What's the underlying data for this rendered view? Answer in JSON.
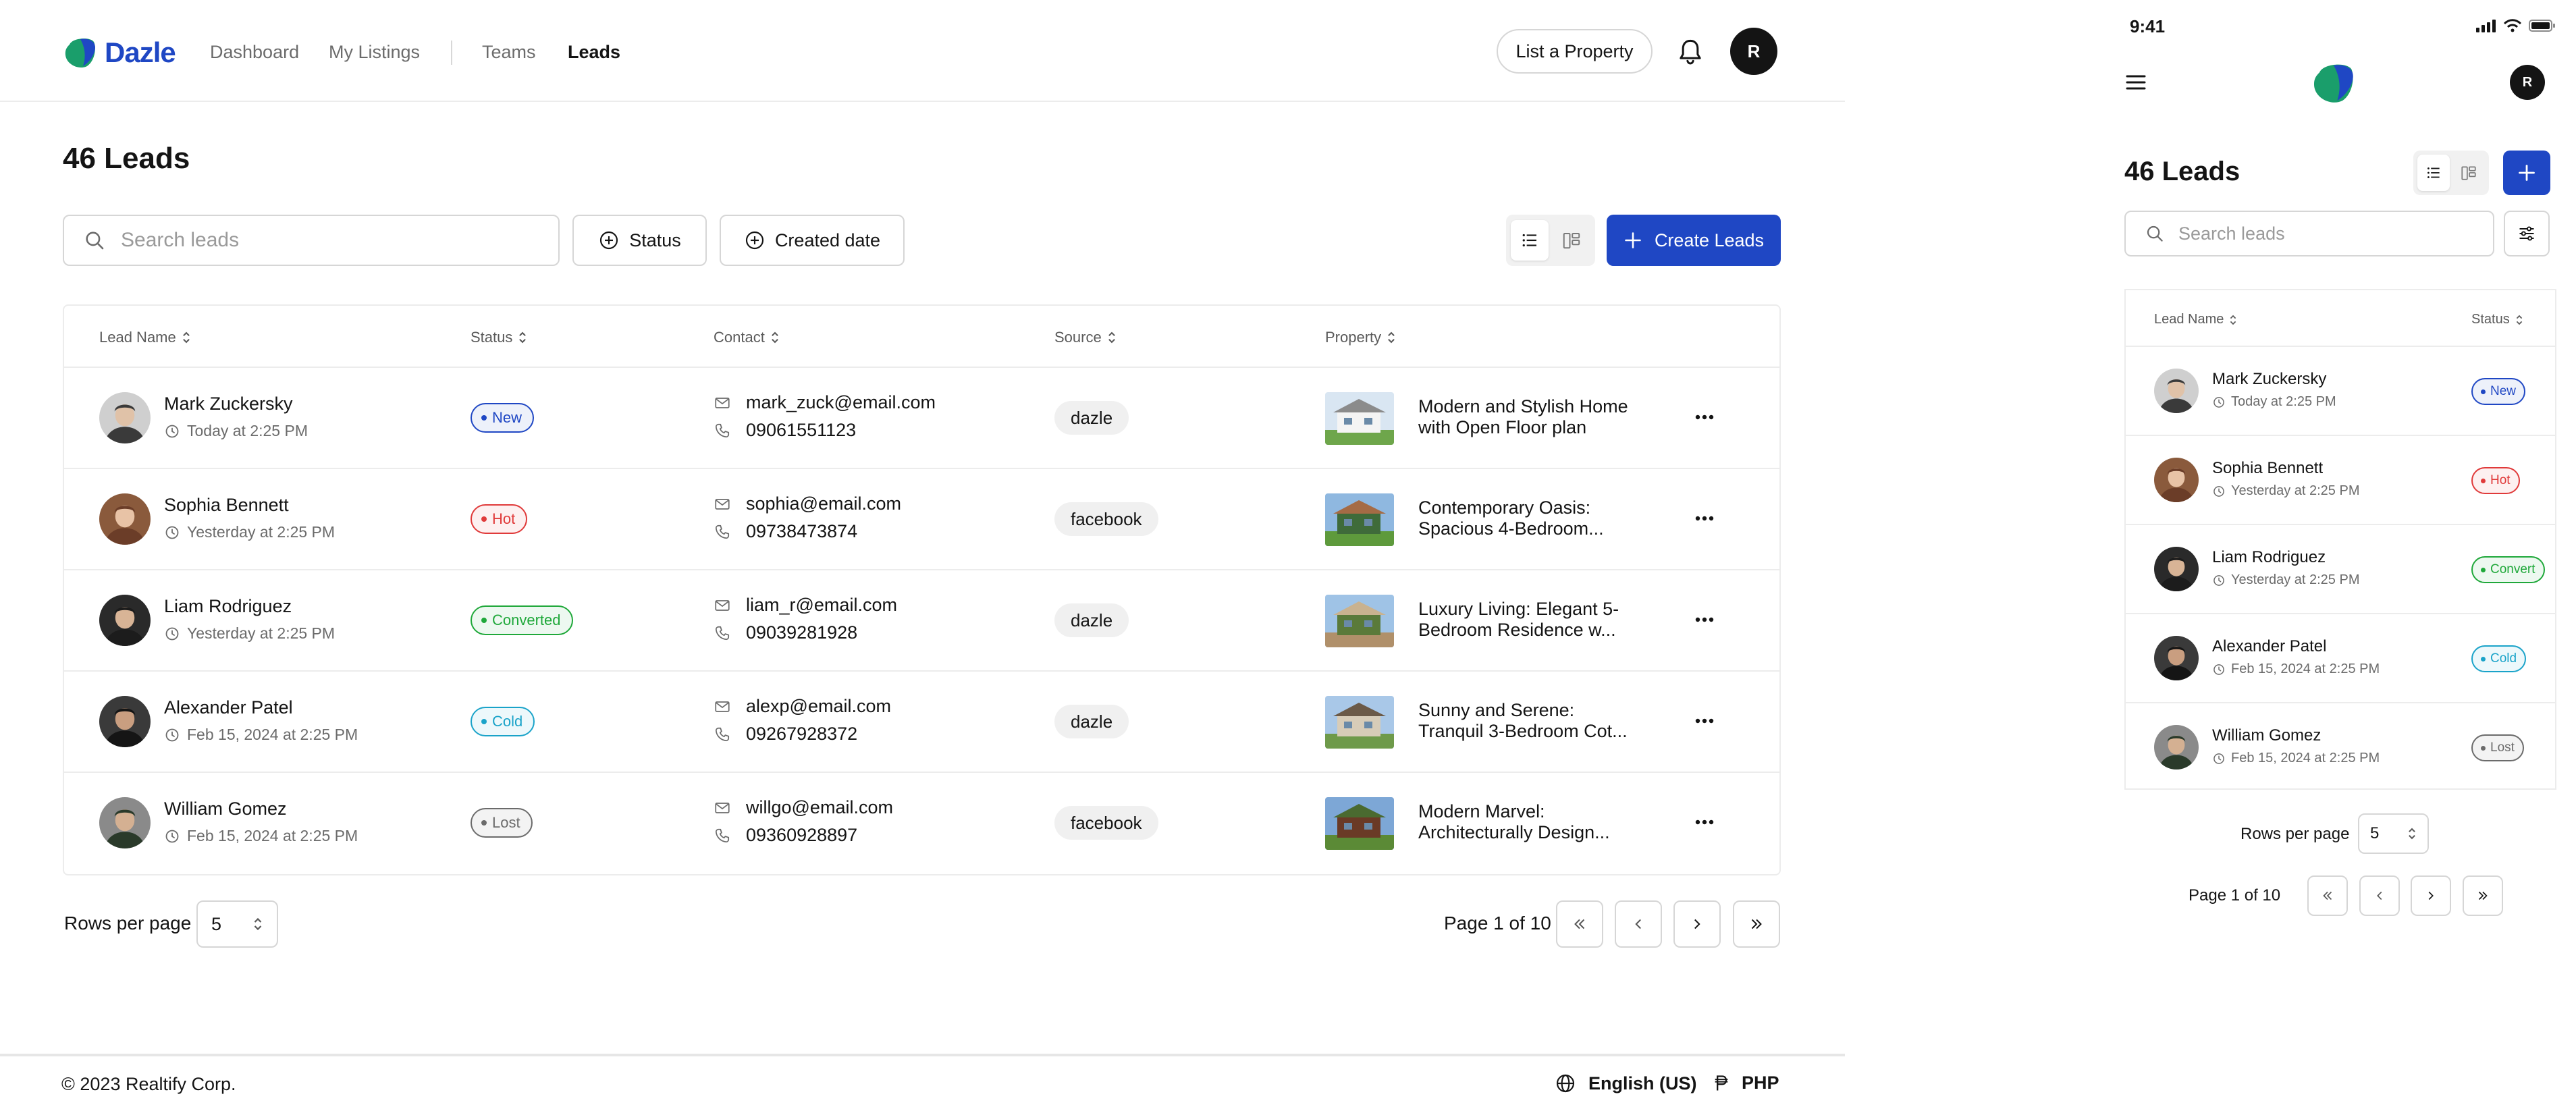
{
  "brand": {
    "name": "Dazle",
    "accent": "#1f47c4"
  },
  "nav": {
    "items": [
      {
        "label": "Dashboard",
        "active": false
      },
      {
        "label": "My Listings",
        "active": false
      },
      {
        "label": "Teams",
        "active": false
      },
      {
        "label": "Leads",
        "active": true
      }
    ],
    "list_property_label": "List a Property",
    "avatar_initial": "R"
  },
  "page": {
    "title": "46 Leads",
    "search_placeholder": "Search leads",
    "filters": [
      {
        "label": "Status",
        "icon": "plus-circle-icon"
      },
      {
        "label": "Created date",
        "icon": "plus-circle-icon"
      }
    ],
    "create_label": "Create Leads",
    "view_mode": "list"
  },
  "table": {
    "headers": [
      "Lead Name",
      "Status",
      "Contact",
      "Source",
      "Property"
    ],
    "rows": [
      {
        "name": "Mark Zuckersky",
        "time": "Today at 2:25 PM",
        "status": "New",
        "status_color": "#1f47c4",
        "email": "mark_zuck@email.com",
        "phone": "09061551123",
        "source": "dazle",
        "property": "Modern and Stylish Home with Open Floor plan"
      },
      {
        "name": "Sophia Bennett",
        "time": "Yesterday at 2:25 PM",
        "status": "Hot",
        "status_color": "#e03a3a",
        "email": "sophia@email.com",
        "phone": "09738473874",
        "source": "facebook",
        "property": "Contemporary Oasis: Spacious 4-Bedroom..."
      },
      {
        "name": "Liam Rodriguez",
        "time": "Yesterday at 2:25 PM",
        "status": "Converted",
        "status_color": "#1fa83a",
        "email": "liam_r@email.com",
        "phone": "09039281928",
        "source": "dazle",
        "property": "Luxury Living: Elegant 5-Bedroom Residence w..."
      },
      {
        "name": "Alexander Patel",
        "time": "Feb 15, 2024 at 2:25 PM",
        "status": "Cold",
        "status_color": "#1aa3c9",
        "email": "alexp@email.com",
        "phone": "09267928372",
        "source": "dazle",
        "property": "Sunny and Serene: Tranquil 3-Bedroom Cot..."
      },
      {
        "name": "William Gomez",
        "time": "Feb 15, 2024 at 2:25 PM",
        "status": "Lost",
        "status_color": "#6b6b6b",
        "email": "willgo@email.com",
        "phone": "09360928897",
        "source": "facebook",
        "property": "Modern Marvel: Architecturally Design..."
      }
    ]
  },
  "pagination": {
    "rows_label": "Rows per page",
    "rows_value": "5",
    "page_info": "Page 1 of 10"
  },
  "footer": {
    "copyright": "© 2023 Realtify Corp.",
    "language": "English (US)",
    "currency": "PHP"
  },
  "mobile": {
    "time": "9:41",
    "avatar_initial": "R",
    "title": "46 Leads",
    "search_placeholder": "Search leads",
    "headers": [
      "Lead Name",
      "Status"
    ],
    "status_labels": [
      "New",
      "Hot",
      "Convert",
      "Cold",
      "Lost"
    ],
    "rows_label": "Rows per page",
    "rows_value": "5",
    "page_info": "Page 1 of 10"
  }
}
